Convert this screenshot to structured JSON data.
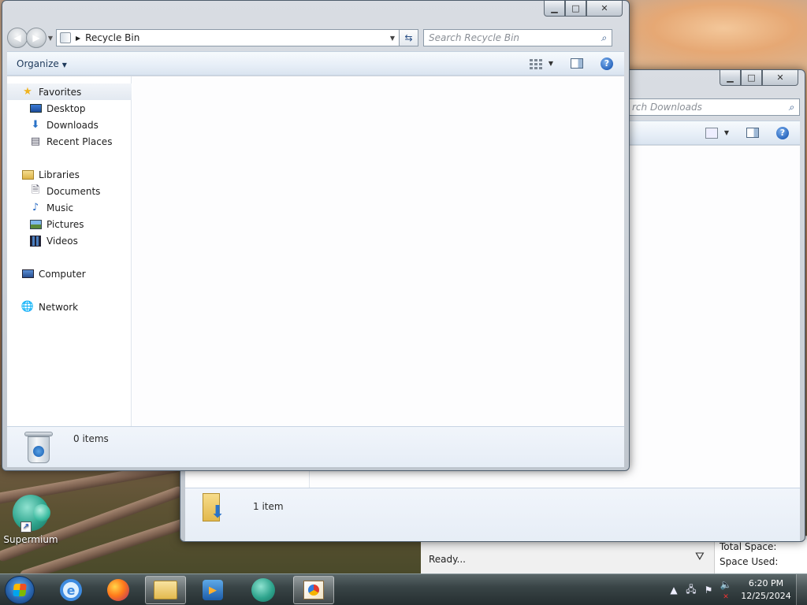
{
  "desktop": {
    "icons": [
      {
        "label": "Supermium"
      }
    ]
  },
  "back_window": {
    "search_placeholder": "Search Downloads",
    "search_visible_text": "rch Downloads",
    "details_text": "1 item"
  },
  "front_window": {
    "breadcrumb": "Recycle Bin",
    "search_placeholder": "Search Recycle Bin",
    "organize_label": "Organize",
    "nav": {
      "favorites": {
        "label": "Favorites",
        "items": [
          "Desktop",
          "Downloads",
          "Recent Places"
        ]
      },
      "libraries": {
        "label": "Libraries",
        "items": [
          "Documents",
          "Music",
          "Pictures",
          "Videos"
        ]
      },
      "computer": "Computer",
      "network": "Network"
    },
    "details_text": "0 items"
  },
  "underlying_app": {
    "status": "Ready...",
    "stats": [
      "Total Space:",
      "Space Used:"
    ]
  },
  "taskbar": {
    "time": "6:20 PM",
    "date": "12/25/2024"
  },
  "colors": {
    "accent": "#1f5db8",
    "selection_bg": "#e3e9f1"
  }
}
